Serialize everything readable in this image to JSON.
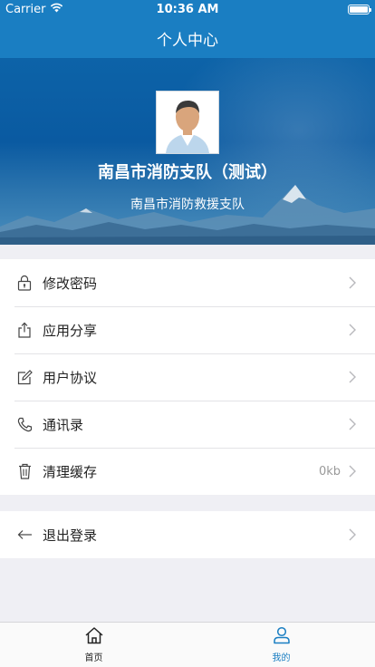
{
  "status_bar": {
    "carrier": "Carrier",
    "time": "10:36 AM"
  },
  "nav": {
    "title": "个人中心"
  },
  "profile": {
    "name": "南昌市消防支队（测试）",
    "department": "南昌市消防救援支队"
  },
  "menu": [
    {
      "label": "修改密码",
      "icon": "lock-icon"
    },
    {
      "label": "应用分享",
      "icon": "share-icon"
    },
    {
      "label": "用户协议",
      "icon": "edit-icon"
    },
    {
      "label": "通讯录",
      "icon": "phone-icon"
    },
    {
      "label": "清理缓存",
      "icon": "trash-icon",
      "value": "0kb"
    }
  ],
  "logout": {
    "label": "退出登录",
    "icon": "back-arrow-icon"
  },
  "tabs": [
    {
      "label": "首页",
      "icon": "home-icon"
    },
    {
      "label": "我的",
      "icon": "user-icon"
    }
  ],
  "colors": {
    "accent": "#1a7ec2",
    "background": "#efeff4"
  }
}
